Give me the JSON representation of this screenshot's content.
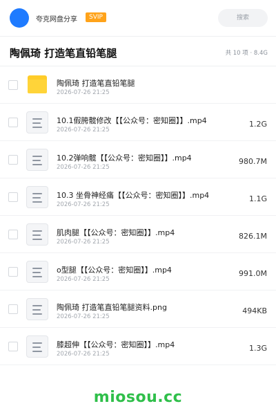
{
  "header": {
    "username": "夸克网盘分享",
    "badge": "SVIP",
    "search_placeholder": "搜索"
  },
  "title_bar": {
    "title": "陶佩琦 打造笔直铅笔腿",
    "summary": "共 10 项 · 8.4G"
  },
  "files": [
    {
      "name": "陶佩琦 打造笔直铅笔腿",
      "date": "2026-07-26 21:25",
      "size": "",
      "type": "folder-icon"
    },
    {
      "name": "10.1假胯髋修改【【公众号：密知圈】】.mp4",
      "date": "2026-07-26 21:25",
      "size": "1.2G",
      "type": "document-icon"
    },
    {
      "name": "10.2弹响髋【【公众号：密知圈】】.mp4",
      "date": "2026-07-26 21:25",
      "size": "980.7M",
      "type": "document-icon"
    },
    {
      "name": "10.3 坐骨神经痛【【公众号：密知圈】】.mp4",
      "date": "2026-07-26 21:25",
      "size": "1.1G",
      "type": "document-icon"
    },
    {
      "name": "肌肉腿【【公众号：密知圈】】.mp4",
      "date": "2026-07-26 21:25",
      "size": "826.1M",
      "type": "document-icon"
    },
    {
      "name": "o型腿【【公众号：密知圈】】.mp4",
      "date": "2026-07-26 21:25",
      "size": "991.0M",
      "type": "document-icon"
    },
    {
      "name": "陶佩琦 打造笔直铅笔腿资料.png",
      "date": "2026-07-26 21:25",
      "size": "494KB",
      "type": "document-icon"
    },
    {
      "name": "膝超伸【【公众号：密知圈】】.mp4",
      "date": "2026-07-26 21:25",
      "size": "1.3G",
      "type": "document-icon"
    }
  ],
  "footer": {
    "brand": "miosou.cc"
  },
  "colors": {
    "accent": "#1f7bff",
    "badge": "#ffa31a",
    "folder": "#ffd439",
    "brand": "#2fbf4a"
  }
}
